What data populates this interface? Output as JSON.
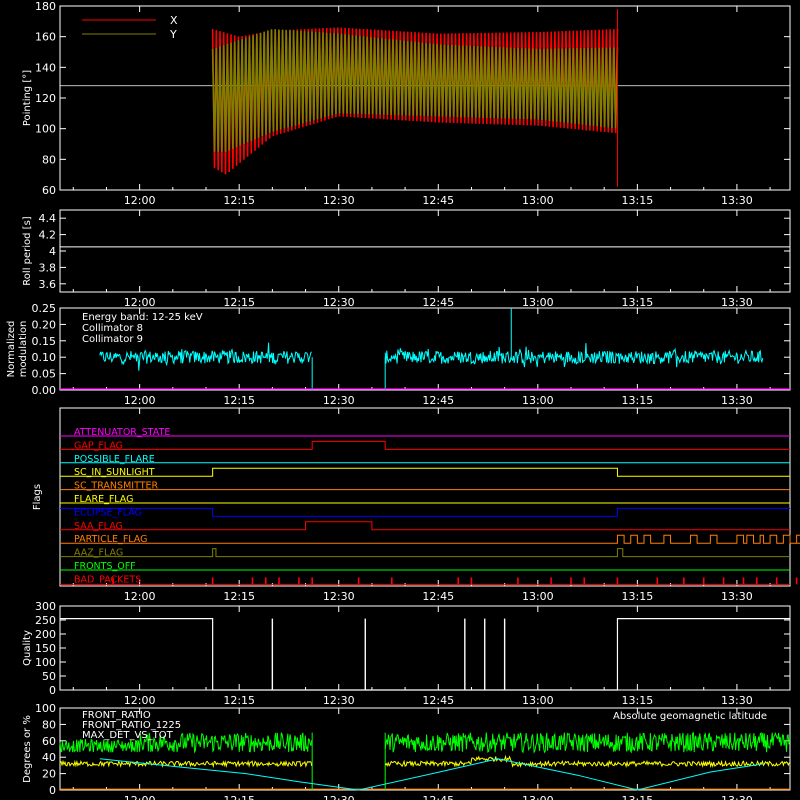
{
  "chart_data": [
    {
      "id": "pointing",
      "type": "line",
      "ylabel": "Pointing [°]",
      "ylim": [
        60,
        180
      ],
      "yticks": [
        60,
        80,
        100,
        120,
        140,
        160,
        180
      ],
      "xticks": [
        "12:00",
        "12:15",
        "12:30",
        "12:45",
        "13:00",
        "13:15",
        "13:30"
      ],
      "legend": [
        {
          "name": "X",
          "color": "#ff0000"
        },
        {
          "name": "Y",
          "color": "#808000"
        }
      ],
      "series": [
        {
          "name": "X",
          "color": "#ff0000",
          "x_start": "12:11",
          "x_end": "13:12",
          "envelope_upper": [
            [
              11,
              165
            ],
            [
              15,
              160
            ],
            [
              20,
              164
            ],
            [
              30,
              166
            ],
            [
              45,
              162
            ],
            [
              60,
              163
            ],
            [
              72,
              165
            ]
          ],
          "envelope_lower": [
            [
              11,
              75
            ],
            [
              13,
              70
            ],
            [
              20,
              95
            ],
            [
              30,
              108
            ],
            [
              45,
              104
            ],
            [
              60,
              102
            ],
            [
              72,
              97
            ]
          ]
        },
        {
          "name": "Y",
          "color": "#808000",
          "x_start": "12:11",
          "x_end": "13:12",
          "envelope_upper": [
            [
              11,
              152
            ],
            [
              20,
              165
            ],
            [
              30,
              162
            ],
            [
              45,
              155
            ],
            [
              60,
              152
            ],
            [
              72,
              153
            ]
          ],
          "envelope_lower": [
            [
              11,
              85
            ],
            [
              13,
              85
            ],
            [
              20,
              98
            ],
            [
              30,
              110
            ],
            [
              45,
              108
            ],
            [
              60,
              106
            ],
            [
              72,
              100
            ]
          ]
        }
      ],
      "reference_line": 128
    },
    {
      "id": "roll",
      "type": "line",
      "ylabel": "Roll period [s]",
      "ylim": [
        3.5,
        4.5
      ],
      "yticks": [
        3.6,
        3.8,
        4.0,
        4.2,
        4.4
      ],
      "xticks": [
        "12:00",
        "12:15",
        "12:30",
        "12:45",
        "13:00",
        "13:15",
        "13:30"
      ],
      "series": [
        {
          "name": "",
          "color": "#ffffff",
          "constant": 4.05
        }
      ]
    },
    {
      "id": "modulation",
      "type": "line",
      "ylabel": "Normalized modulation",
      "ylim": [
        0,
        0.25
      ],
      "yticks": [
        "0.00",
        "0.05",
        "0.10",
        "0.15",
        "0.20",
        "0.25"
      ],
      "xticks": [
        "12:00",
        "12:15",
        "12:30",
        "12:45",
        "13:00",
        "13:15",
        "13:30"
      ],
      "legend": [
        {
          "name": "Energy band: 12-25 keV",
          "color": "#ffffff"
        },
        {
          "name": "Collimator 8",
          "color": "#00ffff"
        },
        {
          "name": "Collimator 9",
          "color": "#ff00ff"
        }
      ],
      "series": [
        {
          "name": "Collimator 8",
          "color": "#00ffff",
          "mean": 0.1,
          "spread": 0.02,
          "segments": [
            [
              -6,
              26
            ],
            [
              37,
              94
            ]
          ],
          "spikes": [
            [
              56,
              0.25
            ],
            [
              52,
              0.085
            ]
          ]
        },
        {
          "name": "Collimator 9",
          "color": "#ff00ff",
          "constant": 0.0
        }
      ]
    },
    {
      "id": "flags",
      "type": "line",
      "ylabel": "Flags",
      "xticks": [
        "12:00",
        "12:15",
        "12:30",
        "12:45",
        "13:00",
        "13:15",
        "13:30"
      ],
      "flags": [
        {
          "name": "ATTENUATOR_STATE",
          "color": "#ff00ff",
          "steps": []
        },
        {
          "name": "GAP_FLAG",
          "color": "#ff0000",
          "steps": [
            [
              26,
              37
            ]
          ]
        },
        {
          "name": "POSSIBLE_FLARE",
          "color": "#00ffff",
          "steps": []
        },
        {
          "name": "SC_IN_SUNLIGHT",
          "color": "#ffff00",
          "steps": [
            [
              11,
              72
            ]
          ]
        },
        {
          "name": "SC_TRANSMITTER",
          "color": "#ff7f00",
          "steps": []
        },
        {
          "name": "FLARE_FLAG",
          "color": "#ffff00",
          "steps": []
        },
        {
          "name": "ECLIPSE_FLAG",
          "color": "#0000ff",
          "inverse": true,
          "steps": [
            [
              11,
              72
            ]
          ]
        },
        {
          "name": "SAA_FLAG",
          "color": "#ff0000",
          "steps": [
            [
              25,
              35
            ]
          ]
        },
        {
          "name": "PARTICLE_FLAG",
          "color": "#ff7f00",
          "steps": [
            [
              72,
              73
            ],
            [
              74,
              75
            ],
            [
              76,
              77
            ],
            [
              79,
              80
            ],
            [
              83,
              84
            ],
            [
              86,
              87
            ],
            [
              90,
              91
            ],
            [
              91.5,
              92.5
            ],
            [
              93.5,
              94
            ],
            [
              95,
              96
            ],
            [
              97,
              98
            ],
            [
              99,
              100
            ]
          ]
        },
        {
          "name": "AAZ_FLAG",
          "color": "#808000",
          "steps": [
            [
              11,
              11.5
            ],
            [
              72,
              72.8
            ]
          ]
        },
        {
          "name": "FRONTS_OFF",
          "color": "#00ff00",
          "steps": []
        },
        {
          "name": "BAD_PACKETS",
          "color": "#ff0000",
          "spikes": [
            -4,
            11,
            17,
            19,
            21,
            24,
            26,
            33,
            38,
            48,
            50,
            57,
            62,
            65,
            67,
            72,
            78,
            82,
            85,
            88,
            91,
            93,
            96,
            99
          ]
        }
      ]
    },
    {
      "id": "quality",
      "type": "line",
      "ylabel": "Quality",
      "ylim": [
        0,
        300
      ],
      "yticks": [
        0,
        50,
        100,
        150,
        200,
        250,
        300
      ],
      "xticks": [
        "12:00",
        "12:15",
        "12:30",
        "12:45",
        "13:00",
        "13:15",
        "13:30"
      ],
      "series": [
        {
          "name": "",
          "color": "#ffffff",
          "level": 255,
          "low_segments": [
            [
              11,
              72
            ]
          ],
          "spikes": [
            20,
            34,
            49,
            52,
            55
          ]
        }
      ]
    },
    {
      "id": "ratios",
      "type": "line",
      "ylabel": "Degrees or %",
      "ylim": [
        0,
        100
      ],
      "yticks": [
        0,
        20,
        40,
        60,
        80,
        100
      ],
      "xticks": [
        "12:00",
        "12:15",
        "12:30",
        "12:45",
        "13:00",
        "13:15",
        "13:30"
      ],
      "legend": [
        {
          "name": "FRONT_RATIO",
          "color": "#ffff00"
        },
        {
          "name": "FRONT_RATIO_1225",
          "color": "#00ff00"
        },
        {
          "name": "MAX_DET_VS_TOT",
          "color": "#ff7f00"
        },
        {
          "name": "Absolute geomagnetic latitude",
          "color": "#00ffff"
        }
      ],
      "series": [
        {
          "name": "FRONT_RATIO",
          "color": "#ffff00",
          "mean": 32,
          "spread": 3
        },
        {
          "name": "FRONT_RATIO_1225",
          "color": "#00ff00",
          "mean": 58,
          "spread": 12
        },
        {
          "name": "MAX_DET_VS_TOT",
          "color": "#ff7f00",
          "constant": 1
        },
        {
          "name": "Absolute geomagnetic latitude",
          "color": "#00ffff",
          "points": [
            [
              -6,
              38
            ],
            [
              6,
              28
            ],
            [
              16,
              20
            ],
            [
              24,
              10
            ],
            [
              33,
              0
            ],
            [
              43,
              18
            ],
            [
              54,
              38
            ],
            [
              66,
              18
            ],
            [
              75,
              0
            ],
            [
              86,
              22
            ],
            [
              94,
              32
            ]
          ]
        }
      ]
    }
  ]
}
